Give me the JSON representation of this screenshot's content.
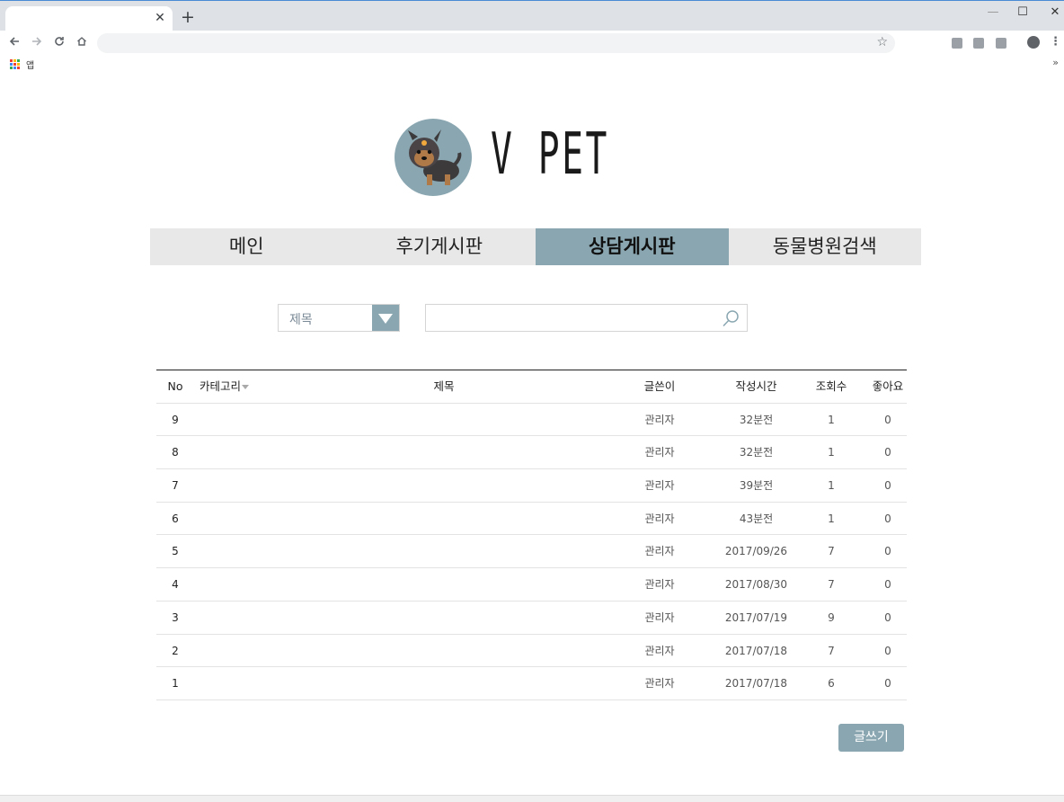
{
  "browser": {
    "tab_close": "✕",
    "new_tab": "+",
    "window_controls": {
      "minimize": "—",
      "maximize": "☐",
      "close": "✕"
    },
    "bookmarks_label": "앱",
    "bookmarks_more": "»",
    "icons": [
      "back-icon",
      "forward-icon",
      "reload-icon",
      "home-icon",
      "star-icon",
      "profile-icon",
      "menu-icon"
    ]
  },
  "site": {
    "logo_text": "V PET",
    "accent_color": "#8aa7b1"
  },
  "nav": {
    "items": [
      {
        "label": "메인",
        "active": false
      },
      {
        "label": "후기게시판",
        "active": false
      },
      {
        "label": "상담게시판",
        "active": true
      },
      {
        "label": "동물병원검색",
        "active": false
      }
    ]
  },
  "search": {
    "select_value": "제목",
    "input_value": ""
  },
  "board": {
    "headers": {
      "no": "No",
      "category": "카테고리",
      "title": "제목",
      "writer": "글쓴이",
      "time": "작성시간",
      "views": "조회수",
      "likes": "좋아요"
    },
    "rows": [
      {
        "no": "9",
        "category": "",
        "title": "",
        "writer": "관리자",
        "time": "32분전",
        "views": "1",
        "likes": "0"
      },
      {
        "no": "8",
        "category": "",
        "title": "",
        "writer": "관리자",
        "time": "32분전",
        "views": "1",
        "likes": "0"
      },
      {
        "no": "7",
        "category": "",
        "title": "",
        "writer": "관리자",
        "time": "39분전",
        "views": "1",
        "likes": "0"
      },
      {
        "no": "6",
        "category": "",
        "title": "",
        "writer": "관리자",
        "time": "43분전",
        "views": "1",
        "likes": "0"
      },
      {
        "no": "5",
        "category": "",
        "title": "",
        "writer": "관리자",
        "time": "2017/09/26",
        "views": "7",
        "likes": "0"
      },
      {
        "no": "4",
        "category": "",
        "title": "",
        "writer": "관리자",
        "time": "2017/08/30",
        "views": "7",
        "likes": "0"
      },
      {
        "no": "3",
        "category": "",
        "title": "",
        "writer": "관리자",
        "time": "2017/07/19",
        "views": "9",
        "likes": "0"
      },
      {
        "no": "2",
        "category": "",
        "title": "",
        "writer": "관리자",
        "time": "2017/07/18",
        "views": "7",
        "likes": "0"
      },
      {
        "no": "1",
        "category": "",
        "title": "",
        "writer": "관리자",
        "time": "2017/07/18",
        "views": "6",
        "likes": "0"
      }
    ]
  },
  "write_button": "글쓰기"
}
